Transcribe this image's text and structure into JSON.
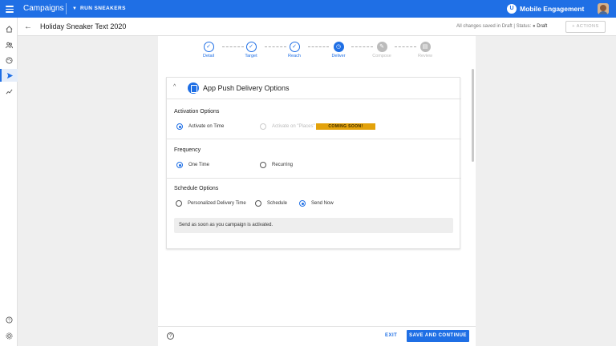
{
  "topbar": {
    "app_title": "Campaigns",
    "campaign_selector": "RUN SNEAKERS",
    "brand_name": "Mobile Engagement",
    "brand_logo_letter": "U"
  },
  "rail": {
    "icons": [
      "home-icon",
      "audience-icon",
      "palette-icon",
      "send-icon",
      "analytics-icon"
    ],
    "bottom_icons": [
      "help-icon",
      "settings-icon"
    ]
  },
  "subheader": {
    "back_icon": "arrow-left-icon",
    "campaign_name": "Holiday Sneaker Text 2020",
    "save_status": "All changes saved in Draft",
    "status_label": "Status:",
    "status_value": "Draft",
    "actions_label": "ACTIONS"
  },
  "steps": [
    {
      "label": "Detail",
      "state": "done",
      "glyph": "✓"
    },
    {
      "label": "Target",
      "state": "done",
      "glyph": "✓"
    },
    {
      "label": "Reach",
      "state": "done",
      "glyph": "✓"
    },
    {
      "label": "Deliver",
      "state": "current",
      "glyph": "◷"
    },
    {
      "label": "Compose",
      "state": "future",
      "glyph": "✎"
    },
    {
      "label": "Review",
      "state": "future",
      "glyph": "▤"
    }
  ],
  "card": {
    "title": "App Push Delivery Options",
    "activation": {
      "title": "Activation Options",
      "options": [
        {
          "label": "Activate on Time",
          "selected": true,
          "disabled": false
        },
        {
          "label": "Activate on \"Places\"",
          "selected": false,
          "disabled": true
        }
      ],
      "badge": "COMING SOON!"
    },
    "frequency": {
      "title": "Frequency",
      "options": [
        {
          "label": "One Time",
          "selected": true
        },
        {
          "label": "Recurring",
          "selected": false
        }
      ]
    },
    "schedule": {
      "title": "Schedule Options",
      "options": [
        {
          "label": "Personalized Delivery Time",
          "selected": false
        },
        {
          "label": "Schedule",
          "selected": false
        },
        {
          "label": "Send Now",
          "selected": true
        }
      ],
      "info": "Send as soon as you campaign is activated."
    }
  },
  "footer": {
    "help_glyph": "?",
    "exit_label": "EXIT",
    "save_label": "SAVE AND CONTINUE"
  },
  "colors": {
    "primary": "#1f6fe5",
    "badge": "#e3a20b"
  }
}
